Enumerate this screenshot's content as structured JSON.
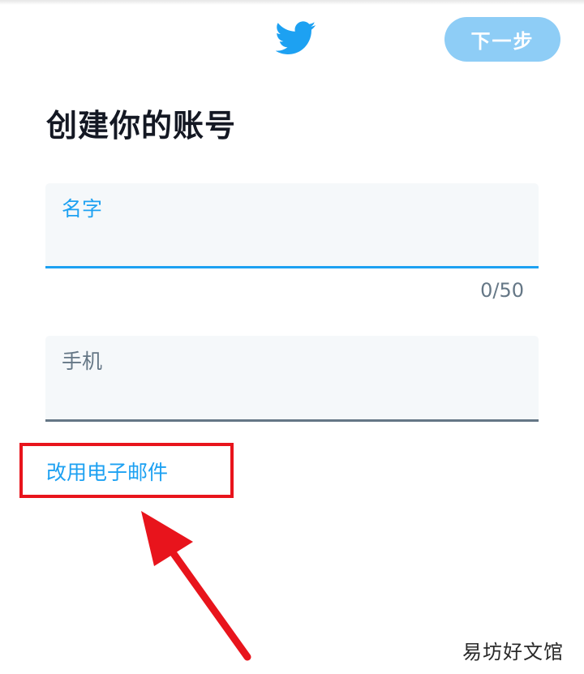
{
  "header": {
    "logo_icon": "twitter-bird-icon",
    "next_label": "下一步",
    "accent_color": "#1da1f2",
    "next_button_color": "#8ecdf6"
  },
  "page": {
    "title": "创建你的账号"
  },
  "form": {
    "name_field": {
      "label": "名字",
      "value": "",
      "counter": "0/50"
    },
    "phone_field": {
      "label": "手机",
      "value": ""
    },
    "use_email_link": "改用电子邮件"
  },
  "annotation": {
    "highlight_color": "#e8141c",
    "arrow_icon": "red-arrow-icon"
  },
  "watermark": {
    "text": "易坊好文馆"
  }
}
